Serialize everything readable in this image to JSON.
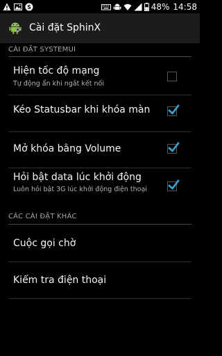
{
  "status_bar": {
    "battery_percent": "48%",
    "time": "14:58",
    "left_icons": [
      "warning-icon",
      "image-icon",
      "sphinx-s-icon"
    ],
    "right_icons": [
      "keyboard-icon",
      "android-debug-icon",
      "wifi-icon",
      "signal-icon",
      "battery-icon"
    ]
  },
  "action_bar": {
    "title": "Cài  đặt SphinX",
    "icon": "android-robot-icon"
  },
  "sections": [
    {
      "header": "CÀI ĐẶT SYSTEMUI",
      "items": [
        {
          "title": "Hiện tốc  độ mạng",
          "summary": "Tự động ẩn khi ngắt kết nối",
          "checked": false
        },
        {
          "title": "Kéo Statusbar khi khóa màn hì",
          "summary": "",
          "checked": true
        },
        {
          "title": "Mở khóa bằng Volume",
          "summary": "",
          "checked": true
        },
        {
          "title": "Hỏi bật data lúc khởi  động",
          "summary": "Luôn hỏi bật 3G lúc khởi  động  điện thoại",
          "checked": true
        }
      ]
    },
    {
      "header": "CÁC CÀI ĐẶT KHÁC",
      "items": [
        {
          "title": "Cuộc gọi chờ"
        },
        {
          "title": "Kiểm tra  điện thoại"
        }
      ]
    }
  ],
  "colors": {
    "accent": "#3aa7d8",
    "background": "#000000",
    "action_bar": "#1c1c1c"
  }
}
